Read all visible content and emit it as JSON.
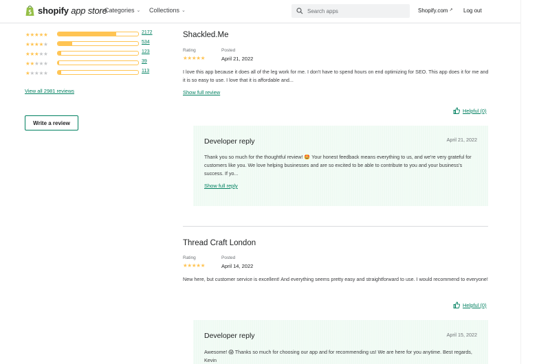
{
  "header": {
    "logo_brand": "shopify",
    "logo_suffix": "app store",
    "nav_categories": "Categories",
    "nav_collections": "Collections",
    "search_placeholder": "Search apps",
    "store_link": "Shopify.com",
    "logout": "Log out"
  },
  "ratings": {
    "rows": [
      {
        "stars": 5,
        "count": "2172",
        "fraction": 0.73
      },
      {
        "stars": 4,
        "count": "534",
        "fraction": 0.18
      },
      {
        "stars": 3,
        "count": "123",
        "fraction": 0.04
      },
      {
        "stars": 2,
        "count": "39",
        "fraction": 0.013
      },
      {
        "stars": 1,
        "count": "113",
        "fraction": 0.04
      }
    ],
    "view_all": "View all 2981 reviews",
    "write_review": "Write a review"
  },
  "reviews": [
    {
      "name": "Shackled.Me",
      "rating_label": "Rating",
      "posted_label": "Posted",
      "rating": 5,
      "date": "April 21, 2022",
      "text": "I love this app because it does all of the leg work for me. I don't have to spend hours on end optimizing for SEO. This app does it for me and it is so easy to use. I love that it is affordable and...",
      "show_full": "Show full review",
      "helpful": "Helpful (0)",
      "reply": {
        "title": "Developer reply",
        "date": "April 21, 2022",
        "text": "Thank you so much for the thoughtful review! 🤩 Your honest feedback means everything to us, and we're very grateful for customers like you. We love helping businesses and are so excited to be able to contribute to you and your business's success. If yo...",
        "show_full": "Show full reply"
      }
    },
    {
      "name": "Thread Craft London",
      "rating_label": "Rating",
      "posted_label": "Posted",
      "rating": 5,
      "date": "April 14, 2022",
      "text": "New here, but customer service is excellent! And everything seems pretty easy and straightforward to use. I would recommend to everyone!",
      "helpful": "Helpful (0)",
      "reply": {
        "title": "Developer reply",
        "date": "April 15, 2022",
        "text": "Awesome! 😱 Thanks so much for choosing our app and for recommending us! We are here for you anytime. Best regards, Kevin"
      }
    }
  ],
  "colors": {
    "accent": "#008060",
    "star": "#ffc453",
    "reply_bg": "#effaf3"
  }
}
